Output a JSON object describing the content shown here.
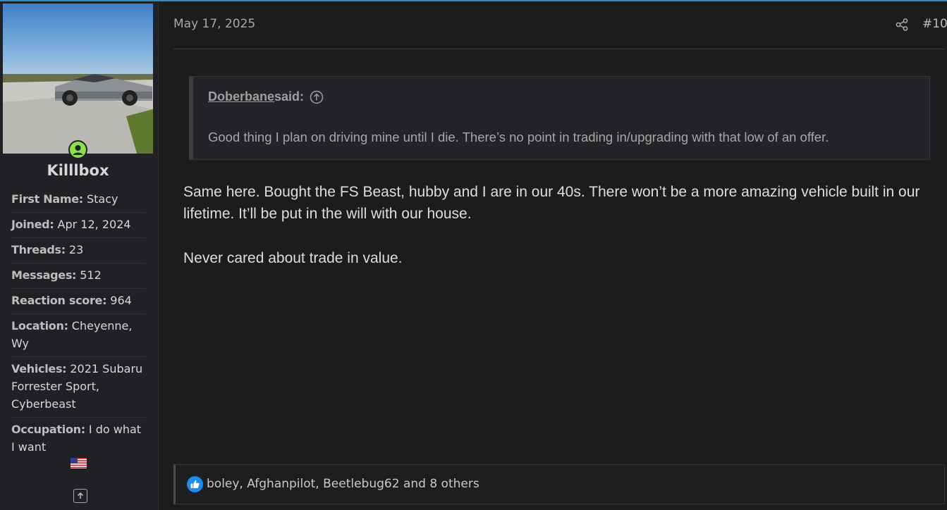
{
  "post": {
    "date": "May 17, 2025",
    "number": "#10",
    "icons": {
      "share": "share-icon",
      "scroll_top": "arrow-up-square-icon",
      "quote_jump": "arrow-up-circle-icon",
      "like": "thumbs-up-icon"
    }
  },
  "user": {
    "name": "Killlbox",
    "avatar": "Cybertruck parked on concrete driveway under blue sky",
    "online_badge": "online-status-icon",
    "fields": [
      {
        "label": "First Name:",
        "value": "Stacy"
      },
      {
        "label": "Joined:",
        "value": "Apr 12, 2024"
      },
      {
        "label": "Threads:",
        "value": "23"
      },
      {
        "label": "Messages:",
        "value": "512"
      },
      {
        "label": "Reaction score:",
        "value": "964"
      },
      {
        "label": "Location:",
        "value": "Cheyenne, Wy"
      },
      {
        "label": "Vehicles:",
        "value": "2021 Subaru Forrester Sport, Cyberbeast"
      },
      {
        "label": "Occupation:",
        "value": "I do what I want"
      }
    ],
    "flag": "us-flag-icon"
  },
  "quote": {
    "author": "Doberbane",
    "said": " said:",
    "text": "Good thing I plan on driving mine until I die. There’s no point in trading in/upgrading with that low of an offer."
  },
  "message": {
    "paragraphs": [
      "Same here. Bought the FS Beast, hubby and I are in our 40s. There won’t be a more amazing vehicle built in our lifetime. It’ll be put in the will with our house.",
      "Never cared about trade in value."
    ]
  },
  "reactions": {
    "text": "boley, Afghanpilot, Beetlebug62 and 8 others"
  },
  "colors": {
    "background": "#1b1c1e",
    "accent_line": "#2a8fc2",
    "online": "#8ee04a",
    "like": "#1b8bf0"
  }
}
